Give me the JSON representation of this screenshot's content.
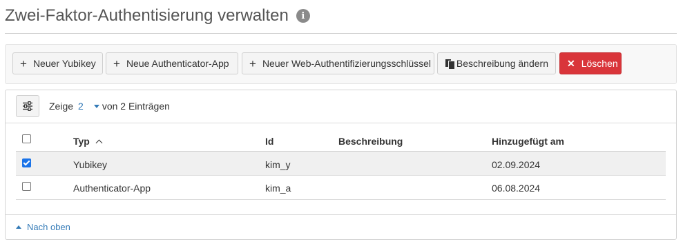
{
  "page": {
    "title": "Zwei-Faktor-Authentisierung verwalten",
    "info_icon": "info-circle-icon"
  },
  "toolbar": {
    "new_yubikey": "Neuer Yubikey",
    "new_authenticator_app": "Neue Authenticator-App",
    "new_webauthn_key": "Neuer Web-Authentifizierungsschlüssel",
    "change_description": "Beschreibung ändern",
    "delete": "Löschen",
    "danger_color": "#d9353a"
  },
  "table_controls": {
    "show_label": "Zeige",
    "page_size": "2",
    "of_entries": "von 2 Einträgen"
  },
  "table": {
    "columns": {
      "type": "Typ",
      "id": "Id",
      "description": "Beschreibung",
      "added_on": "Hinzugefügt am"
    },
    "sort_column": "Typ",
    "sort_direction": "ascending",
    "rows": [
      {
        "selected": true,
        "type": "Yubikey",
        "id": "kim_y",
        "description": "",
        "added_on": "02.09.2024"
      },
      {
        "selected": false,
        "type": "Authenticator-App",
        "id": "kim_a",
        "description": "",
        "added_on": "06.08.2024"
      }
    ]
  },
  "footer": {
    "back_to_top": "Nach oben"
  },
  "colors": {
    "link": "#337ab7",
    "checkbox_checked": "#1a73e8"
  }
}
